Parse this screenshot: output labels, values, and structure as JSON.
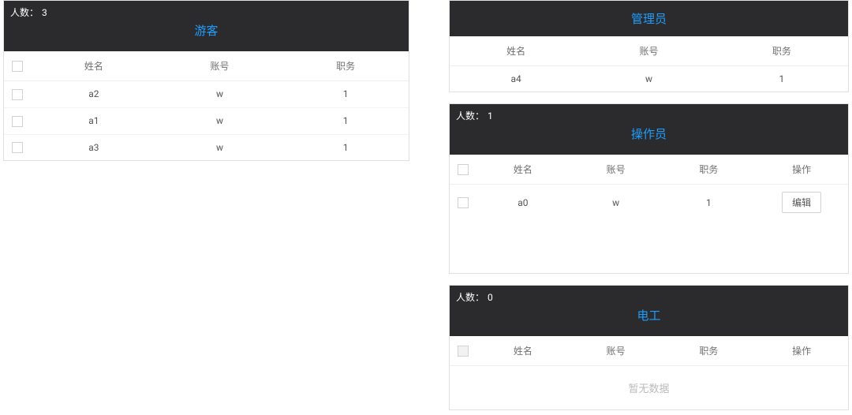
{
  "labels": {
    "count_prefix": "人数：",
    "name": "姓名",
    "account": "账号",
    "role": "职务",
    "action": "操作",
    "edit": "编辑",
    "empty": "暂无数据"
  },
  "panels": {
    "visitor": {
      "title": "游客",
      "count": 3,
      "rows": [
        {
          "name": "a2",
          "account": "w",
          "role": "1"
        },
        {
          "name": "a1",
          "account": "w",
          "role": "1"
        },
        {
          "name": "a3",
          "account": "w",
          "role": "1"
        }
      ]
    },
    "admin": {
      "title": "管理员",
      "rows": [
        {
          "name": "a4",
          "account": "w",
          "role": "1"
        }
      ]
    },
    "operator": {
      "title": "操作员",
      "count": 1,
      "rows": [
        {
          "name": "a0",
          "account": "w",
          "role": "1"
        }
      ]
    },
    "electrician": {
      "title": "电工",
      "count": 0,
      "rows": []
    }
  }
}
